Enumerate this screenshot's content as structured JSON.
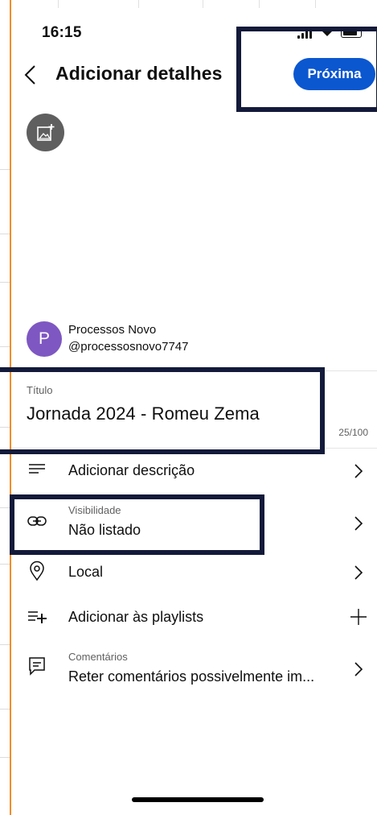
{
  "status_bar": {
    "time": "16:15"
  },
  "header": {
    "title": "Adicionar detalhes",
    "next_label": "Próxima"
  },
  "channel": {
    "avatar_letter": "P",
    "name": "Processos Novo",
    "handle": "@processosnovo7747"
  },
  "title_field": {
    "label": "Título",
    "value": "Jornada 2024 - Romeu Zema",
    "counter": "25/100"
  },
  "options": {
    "description": {
      "label": "Adicionar descrição"
    },
    "visibility": {
      "caption": "Visibilidade",
      "value": "Não listado"
    },
    "location": {
      "label": "Local"
    },
    "playlists": {
      "label": "Adicionar às playlists"
    },
    "comments": {
      "caption": "Comentários",
      "value": "Reter comentários possivelmente im..."
    }
  },
  "colors": {
    "accent": "#0b57d0",
    "avatar": "#7e57c2",
    "highlight_box": "#131a3a",
    "left_edge": "#f28c28"
  }
}
